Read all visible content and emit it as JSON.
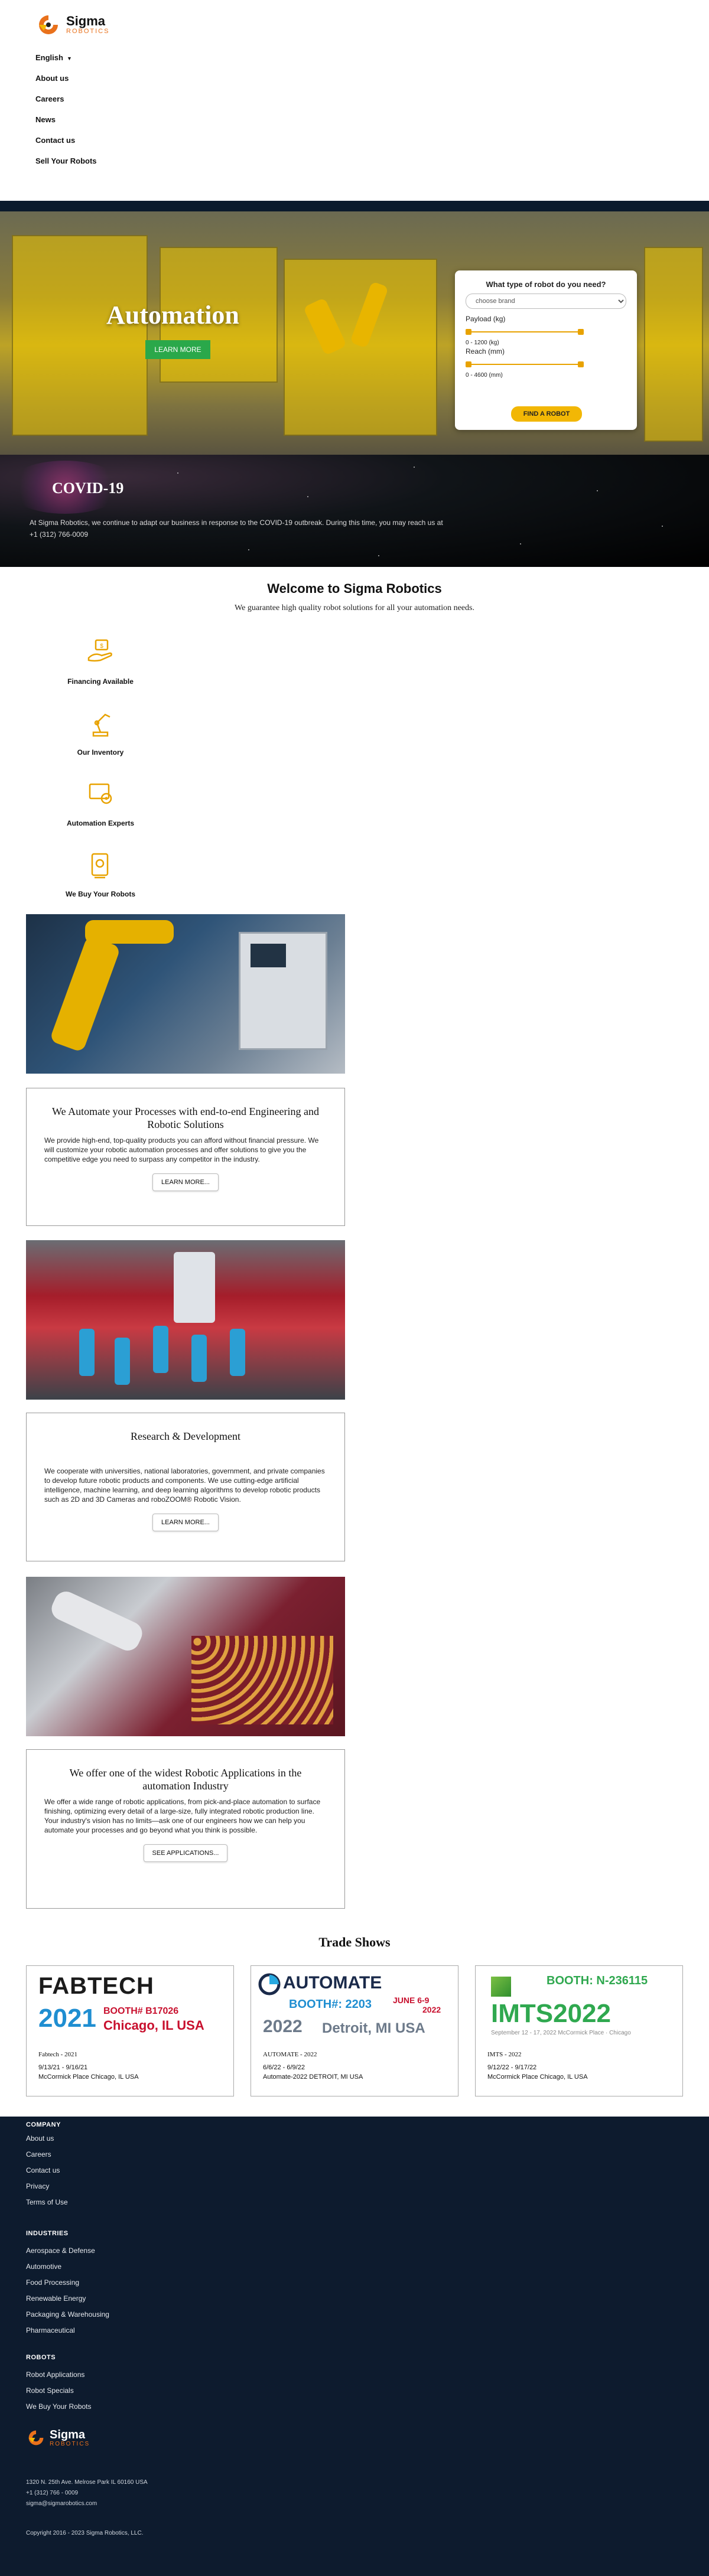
{
  "brand": {
    "name": "Sigma",
    "sub": "ROBOTICS"
  },
  "nav": {
    "language": "English",
    "items": [
      "About us",
      "Careers",
      "News",
      "Contact us",
      "Sell Your Robots"
    ]
  },
  "hero": {
    "title": "Automation",
    "button": "LEARN MORE",
    "finder": {
      "title": "What type of robot do you need?",
      "select_placeholder": "choose brand",
      "payload_label": "Payload (kg)",
      "payload_range": "0 - 1200 (kg)",
      "reach_label": "Reach (mm)",
      "reach_range": "0 - 4600 (mm)",
      "button": "FIND A ROBOT"
    }
  },
  "covid": {
    "title": "COVID-19",
    "text": "At Sigma Robotics, we continue to adapt our business in response to the COVID-19 outbreak. During this time, you may reach us at",
    "phone": "+1 (312) 766-0009"
  },
  "welcome": {
    "title": "Welcome to Sigma Robotics",
    "subtitle": "We guarantee high quality robot solutions for all your automation needs."
  },
  "features": [
    "Financing Available",
    "Our Inventory",
    "Automation Experts",
    "We Buy Your Robots"
  ],
  "cards": [
    {
      "title": "We Automate your Processes with end-to-end Engineering and Robotic Solutions",
      "text": "We provide high-end, top-quality products you can afford without financial pressure. We will customize your robotic automation processes and offer solutions to give you the competitive edge you need to surpass any competitor in the industry.",
      "button": "LEARN MORE..."
    },
    {
      "title": "Research & Development",
      "text": "We cooperate with universities, national laboratories, government, and private companies to develop future robotic products and components. We use cutting-edge artificial intelligence, machine learning, and deep learning algorithms to develop robotic products such as 2D and 3D Cameras and roboZOOM® Robotic Vision.",
      "button": "LEARN MORE..."
    },
    {
      "title": "We offer one of the widest Robotic Applications in the automation Industry",
      "text": "We offer a wide range of robotic applications, from pick-and-place automation to surface finishing, optimizing every detail of a large-size, fully integrated robotic production line. Your industry's vision has no limits—ask one of our engineers how we can help you automate your processes and go beyond what you think is possible.",
      "button": "SEE APPLICATIONS..."
    }
  ],
  "trade": {
    "title": "Trade Shows",
    "shows": [
      {
        "logo_brand": "FABTECH",
        "logo_year": "2021",
        "logo_booth": "BOOTH# B17026",
        "logo_city": "Chicago, IL USA",
        "name": "Fabtech - 2021",
        "dates": "9/13/21 - 9/16/21",
        "location": "McCormick Place Chicago, IL USA"
      },
      {
        "logo_brand": "AUTOMATE",
        "logo_booth": "BOOTH#: 2203",
        "logo_dates": "JUNE 6-9",
        "logo_dates_year": "2022",
        "logo_year": "2022",
        "logo_city": "Detroit, MI USA",
        "name": "AUTOMATE - 2022",
        "dates": "6/6/22 - 6/9/22",
        "location": "Automate-2022 DETROIT, MI USA"
      },
      {
        "logo_booth": "BOOTH: N-236115",
        "logo_brand": "IMTS2022",
        "logo_sub": "September 12 - 17, 2022   McCormick Place · Chicago",
        "name": "IMTS - 2022",
        "dates": "9/12/22 - 9/17/22",
        "location": "McCormick Place Chicago, IL USA"
      }
    ]
  },
  "footer": {
    "company_title": "COMPANY",
    "company": [
      "About us",
      "Careers",
      "Contact us",
      "Privacy",
      "Terms of Use"
    ],
    "industries_title": "INDUSTRIES",
    "industries": [
      "Aerospace & Defense",
      "Automotive",
      "Food Processing",
      "Renewable Energy",
      "Packaging & Warehousing",
      "Pharmaceutical"
    ],
    "robots_title": "ROBOTS",
    "robots": [
      "Robot Applications",
      "Robot Specials",
      "We Buy Your Robots"
    ],
    "address": "1320 N. 25th Ave. Melrose Park IL 60160 USA",
    "phone": "+1 (312) 766 - 0009",
    "email": "sigma@sigmarobotics.com",
    "copyright": "Copyright 2016 - 2023 Sigma Robotics, LLC."
  },
  "colors": {
    "accent": "#e9711c",
    "green": "#2aa84a",
    "yellow": "#f2b705",
    "footer_bg": "#0d1b2e"
  }
}
